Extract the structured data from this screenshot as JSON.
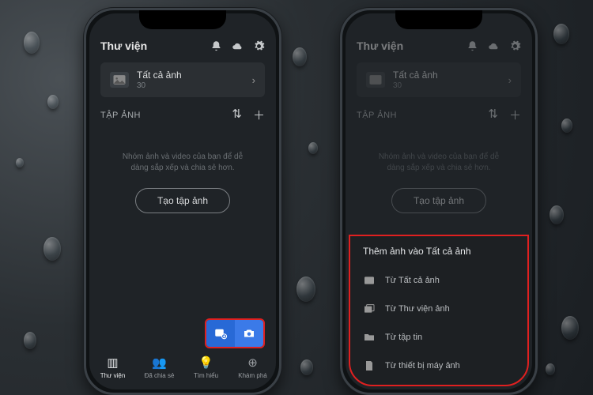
{
  "app": {
    "library_title": "Thư viện",
    "album_card": {
      "title": "Tất cả ảnh",
      "count": "30"
    },
    "section_label": "TẬP ẢNH",
    "empty_text_1": "Nhóm ảnh và video của bạn để dễ",
    "empty_text_2": "dàng sắp xếp và chia sẻ hơn.",
    "create_button": "Tạo tập ảnh",
    "nav": [
      {
        "label": "Thư viện"
      },
      {
        "label": "Đã chia sẻ"
      },
      {
        "label": "Tìm hiểu"
      },
      {
        "label": "Khám phá"
      }
    ]
  },
  "sheet": {
    "title": "Thêm ảnh vào Tất cả ảnh",
    "items": [
      {
        "label": "Từ Tất cả ảnh"
      },
      {
        "label": "Từ Thư viện ảnh"
      },
      {
        "label": "Từ tập tin"
      },
      {
        "label": "Từ thiết bị máy ảnh"
      }
    ]
  }
}
